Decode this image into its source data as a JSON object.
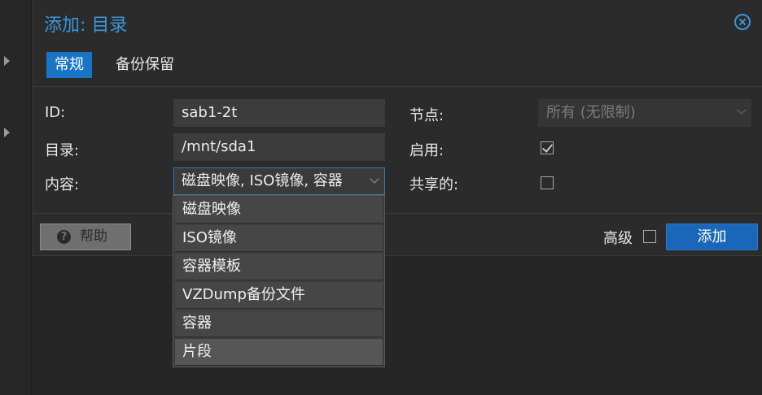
{
  "dialog": {
    "title": "添加: 目录",
    "tabs": [
      "常规",
      "备份保留"
    ],
    "form": {
      "id_label": "ID:",
      "id_value": "sab1-2t",
      "dir_label": "目录:",
      "dir_value": "/mnt/sda1",
      "content_label": "内容:",
      "content_value": "磁盘映像, ISO镜像, 容器",
      "node_label": "节点:",
      "node_value": "所有 (无限制)",
      "enable_label": "启用:",
      "enable_checked": true,
      "shared_label": "共享的:",
      "shared_checked": false
    },
    "footer": {
      "help_label": "帮助",
      "advanced_label": "高级",
      "advanced_checked": false,
      "add_label": "添加"
    }
  },
  "content_dropdown": {
    "options": [
      "磁盘映像",
      "ISO镜像",
      "容器模板",
      "VZDump备份文件",
      "容器",
      "片段"
    ],
    "hovered_option": "片段"
  },
  "colors": {
    "accent": "#3a96dd",
    "active_tab": "#1a75c7",
    "primary_button": "#1a66b8"
  }
}
